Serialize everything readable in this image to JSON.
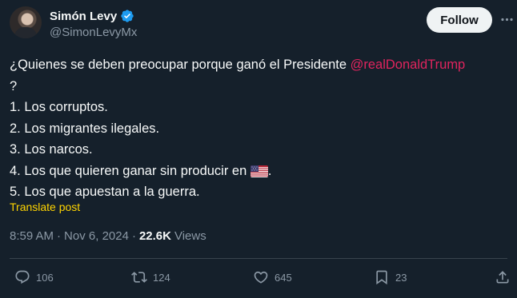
{
  "author": {
    "name": "Simón Levy",
    "handle": "@SimonLevyMx",
    "verified_icon": "verified-badge-icon"
  },
  "header": {
    "follow_label": "Follow",
    "more_icon": "more-options-icon"
  },
  "tweet": {
    "line1_text": "¿Quienes se deben preocupar porque ganó el Presidente ",
    "mention": "@realDonaldTrump",
    "line1_end": "?",
    "items": [
      "1. Los corruptos.",
      "2. Los migrantes ilegales.",
      "3. Los narcos.",
      "4. Los que quieren ganar sin producir en ",
      "5. Los que apuestan a la guerra."
    ],
    "item4_suffix": ".",
    "flag_emoji": "🇺🇸"
  },
  "translate_label": "Translate post",
  "meta": {
    "time": "8:59 AM",
    "date": "Nov 6, 2024",
    "separator": "·",
    "views_count": "22.6K",
    "views_label": "Views"
  },
  "actions": {
    "replies": "106",
    "reposts": "124",
    "likes": "645",
    "bookmarks": "23"
  },
  "colors": {
    "background": "#15202b",
    "mention": "#e0245e",
    "translate": "#ffd400",
    "verified": "#1d9bf0"
  }
}
